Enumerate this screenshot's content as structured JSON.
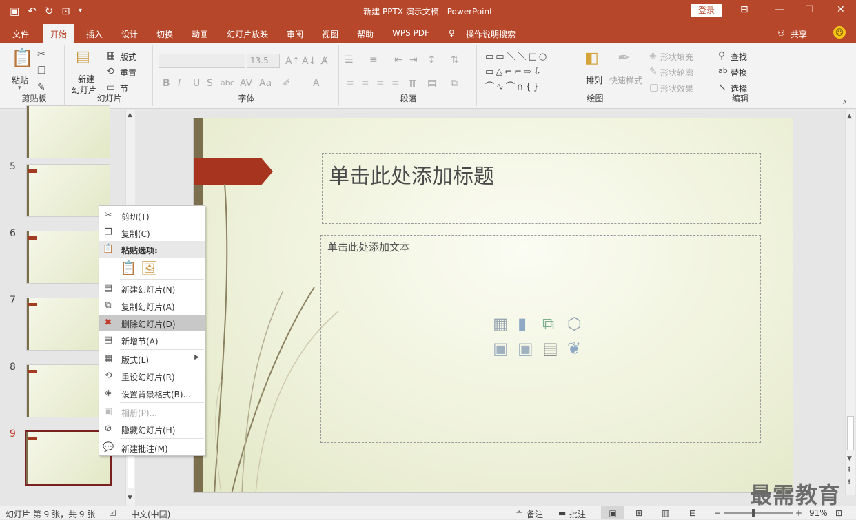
{
  "window": {
    "title": "新建 PPTX 演示文稿 - PowerPoint",
    "login": "登录",
    "share": "共享"
  },
  "tabs": [
    "文件",
    "开始",
    "插入",
    "设计",
    "切换",
    "动画",
    "幻灯片放映",
    "审阅",
    "视图",
    "帮助",
    "WPS PDF",
    "操作说明搜索"
  ],
  "ribbon": {
    "clipboard": {
      "label": "剪贴板",
      "paste": "粘贴"
    },
    "slides": {
      "label": "幻灯片",
      "new_slide_1": "新建",
      "new_slide_2": "幻灯片",
      "layout": "版式",
      "reset": "重置",
      "section": "节"
    },
    "font": {
      "label": "字体",
      "size": "13.5"
    },
    "paragraph": {
      "label": "段落"
    },
    "drawing": {
      "label": "绘图",
      "arrange": "排列",
      "quick_styles": "快速样式",
      "fill": "形状填充",
      "outline": "形状轮廓",
      "effects": "形状效果"
    },
    "editing": {
      "label": "编辑",
      "find": "查找",
      "replace": "替换",
      "select": "选择"
    }
  },
  "slides": [
    {
      "num": "5"
    },
    {
      "num": "6"
    },
    {
      "num": "7"
    },
    {
      "num": "8"
    },
    {
      "num": "9"
    }
  ],
  "slide": {
    "title_placeholder": "单击此处添加标题",
    "body_placeholder": "单击此处添加文本"
  },
  "context_menu": {
    "cut": "剪切(T)",
    "copy": "复制(C)",
    "paste_options": "粘贴选项:",
    "new_slide": "新建幻灯片(N)",
    "duplicate": "复制幻灯片(A)",
    "delete": "删除幻灯片(D)",
    "new_section": "新增节(A)",
    "layout": "版式(L)",
    "reset": "重设幻灯片(R)",
    "format_bg": "设置背景格式(B)...",
    "photo_album": "相册(P)...",
    "hide": "隐藏幻灯片(H)",
    "new_comment": "新建批注(M)"
  },
  "status": {
    "slide_info": "幻灯片 第 9 张，共 9 张",
    "language": "中文(中国)",
    "notes": "备注",
    "comments": "批注",
    "zoom": "91%"
  },
  "watermark": "最需教育",
  "colors": {
    "accent": "#b7472a",
    "highlight": "#c8c8c8"
  }
}
